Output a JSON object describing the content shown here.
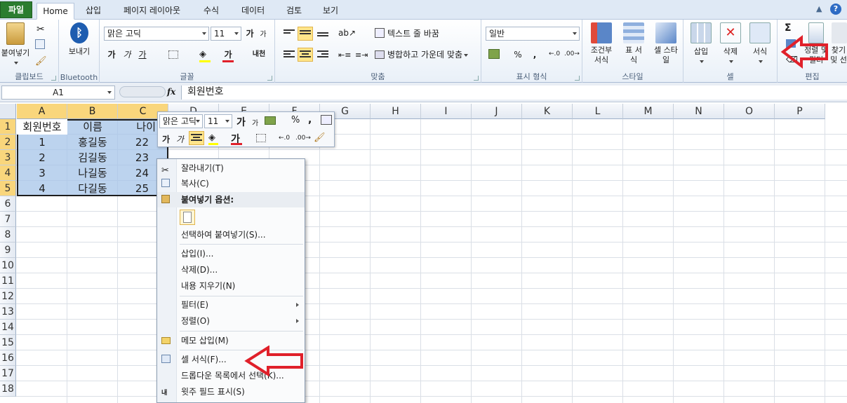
{
  "tabs": {
    "file": "파일",
    "home": "Home",
    "insert": "삽입",
    "page_layout": "페이지 레이아웃",
    "formulas": "수식",
    "data": "데이터",
    "review": "검토",
    "view": "보기"
  },
  "clipboard": {
    "paste": "붙여넣기",
    "label": "클립보드"
  },
  "bluetooth": {
    "send": "보내기",
    "label": "Bluetooth"
  },
  "font": {
    "name": "맑은 고딕",
    "size": "11",
    "bold": "가",
    "italic": "가",
    "underline": "가",
    "grow": "가",
    "shrink": "가",
    "font_color": "가",
    "phonetic": "내천",
    "label": "글꼴"
  },
  "alignment": {
    "wrap": "텍스트 줄 바꿈",
    "merge": "병합하고 가운데 맞춤",
    "label": "맞춤"
  },
  "number": {
    "format": "일반",
    "percent": "%",
    "comma": ",",
    "label": "표시 형식"
  },
  "styles": {
    "conditional": "조건부 서식",
    "table": "표 서식",
    "cell": "셀 스타일",
    "label": "스타일"
  },
  "cells": {
    "insert": "삽입",
    "delete": "삭제",
    "format": "서식",
    "label": "셀"
  },
  "editing": {
    "sigma": "Σ",
    "sort_filter": "정렬 및 필터",
    "find": "찾기 및 선택",
    "label": "편집"
  },
  "formula_bar": {
    "name_box": "A1",
    "fx": "fx",
    "value": "회원번호"
  },
  "columns": [
    "A",
    "B",
    "C",
    "D",
    "E",
    "F",
    "G",
    "H",
    "I",
    "J",
    "K",
    "L",
    "M",
    "N",
    "O",
    "P"
  ],
  "rows": [
    "1",
    "2",
    "3",
    "4",
    "5",
    "6",
    "7",
    "8",
    "9",
    "10",
    "11",
    "12",
    "13",
    "14",
    "15",
    "16",
    "17",
    "18"
  ],
  "sheet": {
    "header": [
      "회원번호",
      "이름",
      "나이"
    ],
    "data": [
      [
        "1",
        "홍길동",
        "22"
      ],
      [
        "2",
        "김길동",
        "23"
      ],
      [
        "3",
        "나길동",
        "24"
      ],
      [
        "4",
        "다길동",
        "25"
      ]
    ]
  },
  "mini_toolbar": {
    "font": "맑은 고딕",
    "size": "11",
    "grow": "가",
    "shrink": "가",
    "percent": "%",
    "comma": ",",
    "bold": "가",
    "italic": "가",
    "font_color": "가"
  },
  "context_menu": {
    "cut": "잘라내기(T)",
    "copy": "복사(C)",
    "paste_options": "붙여넣기 옵션:",
    "paste_special": "선택하여 붙여넣기(S)...",
    "insert": "삽입(I)...",
    "delete": "삭제(D)...",
    "clear": "내용 지우기(N)",
    "filter": "필터(E)",
    "sort": "정렬(O)",
    "comment": "메모 삽입(M)",
    "format_cells": "셀 서식(F)...",
    "pick_list": "드롭다운 목록에서 선택(K)...",
    "phonetic": "윗주 필드 표시(S)"
  },
  "colors": {
    "accent": "#2b7d2f",
    "selection": "#a5c4e8",
    "header_selected": "#f9d67c",
    "annotation": "#e0202a"
  }
}
